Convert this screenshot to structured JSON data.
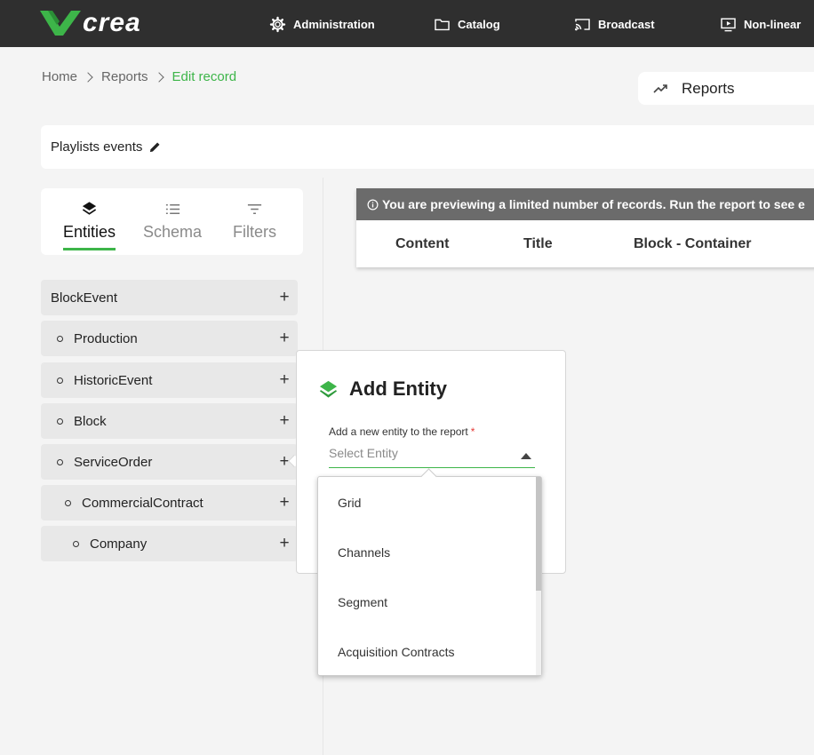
{
  "brand": {
    "name": "crea",
    "accent": "#3db549"
  },
  "nav": [
    {
      "label": "Administration",
      "icon": "gear-icon"
    },
    {
      "label": "Catalog",
      "icon": "folder-icon"
    },
    {
      "label": "Broadcast",
      "icon": "cast-icon"
    },
    {
      "label": "Non-linear",
      "icon": "play-screen-icon"
    }
  ],
  "breadcrumb": {
    "home": "Home",
    "reports": "Reports",
    "current": "Edit record"
  },
  "reports_chip": {
    "label": "Reports",
    "icon": "trending-up-icon"
  },
  "record": {
    "title": "Playlists events",
    "icon": "pencil-icon"
  },
  "tabs": [
    {
      "label": "Entities",
      "icon": "layers-icon",
      "active": true
    },
    {
      "label": "Schema",
      "icon": "list-icon",
      "active": false
    },
    {
      "label": "Filters",
      "icon": "filter-icon",
      "active": false
    }
  ],
  "entities": [
    {
      "label": "BlockEvent",
      "level": 0
    },
    {
      "label": "Production",
      "level": 1
    },
    {
      "label": "HistoricEvent",
      "level": 1
    },
    {
      "label": "Block",
      "level": 1
    },
    {
      "label": "ServiceOrder",
      "level": 1
    },
    {
      "label": "CommercialContract",
      "level": 2
    },
    {
      "label": "Company",
      "level": 3
    }
  ],
  "preview": {
    "banner": "You are previewing a limited number of records. Run the report to see e",
    "columns": [
      "Content",
      "Title",
      "Block - Container"
    ]
  },
  "modal": {
    "title": "Add Entity",
    "field_label": "Add a new entity to the report",
    "required_mark": "*",
    "placeholder": "Select Entity"
  },
  "dropdown_options": [
    "Grid",
    "Channels",
    "Segment",
    "Acquisition Contracts"
  ]
}
